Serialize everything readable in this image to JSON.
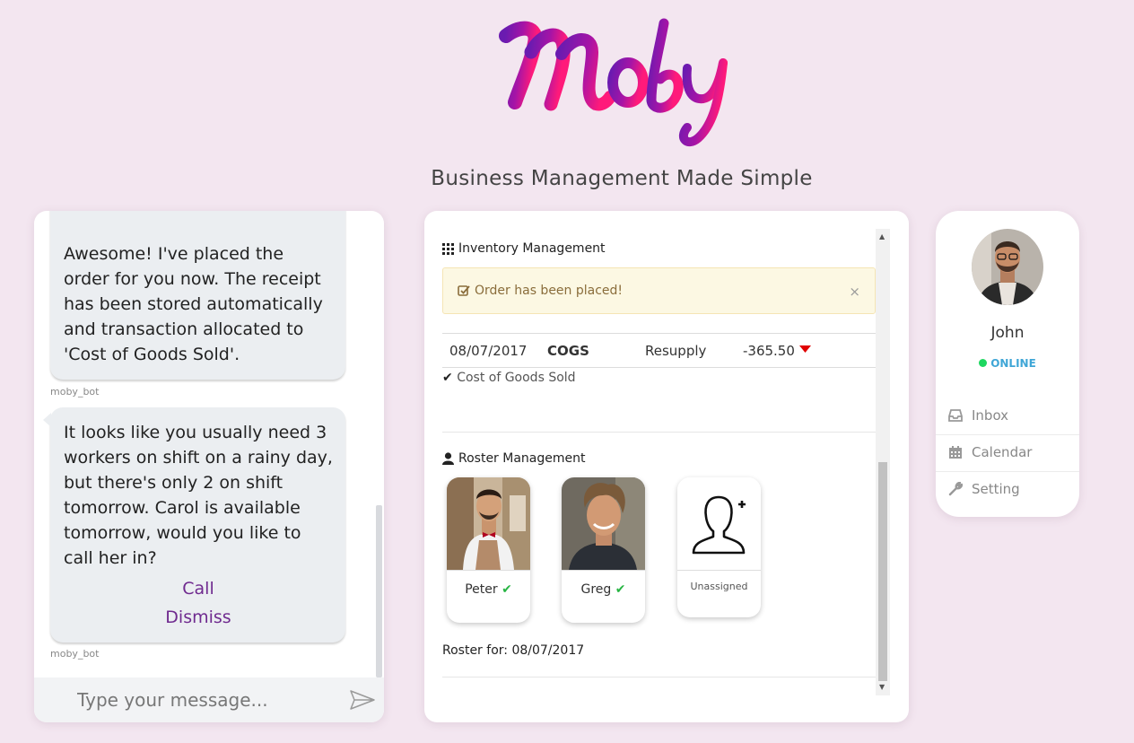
{
  "header": {
    "logo_text": "Moby",
    "tagline": "Business Management Made Simple"
  },
  "chat": {
    "messages": [
      {
        "text": "Awesome! I've placed the order for you now. The receipt has been stored automatically and transaction allocated to 'Cost of Goods Sold'.",
        "sender": "moby_bot"
      },
      {
        "text": "It looks like you usually need 3 workers on shift on a rainy day, but there's only 2 on shift tomorrow. Carol is available tomorrow, would you like to call her in?",
        "actions": [
          "Call",
          "Dismiss"
        ],
        "sender": "moby_bot"
      }
    ],
    "input_placeholder": "Type your message...",
    "send_icon": "paper-plane-icon"
  },
  "inventory": {
    "title": "Inventory Management",
    "alert": "Order has been placed!",
    "alert_close": "×",
    "transaction": {
      "date": "08/07/2017",
      "code": "COGS",
      "type": "Resupply",
      "amount": "-365.50"
    },
    "description": "Cost of Goods Sold"
  },
  "roster": {
    "title": "Roster Management",
    "staff": [
      {
        "name": "Peter",
        "assigned": true
      },
      {
        "name": "Greg",
        "assigned": true
      },
      {
        "name": "Unassigned",
        "assigned": false
      }
    ],
    "roster_for": "Roster for: 08/07/2017"
  },
  "profile": {
    "name": "John",
    "status": "ONLINE",
    "menu": [
      {
        "label": "Inbox",
        "icon": "inbox-icon"
      },
      {
        "label": "Calendar",
        "icon": "calendar-icon"
      },
      {
        "label": "Setting",
        "icon": "wrench-icon"
      }
    ]
  },
  "colors": {
    "background": "#f3e6f0",
    "logo_gradient_start": "#6a1bb0",
    "logo_gradient_end": "#ff1a7a",
    "action_link": "#6f2a8f",
    "online_dot": "#1ed760",
    "status_text": "#3fa6d6",
    "alert_bg": "#fcf8e3",
    "negative_arrow": "#e00000"
  }
}
